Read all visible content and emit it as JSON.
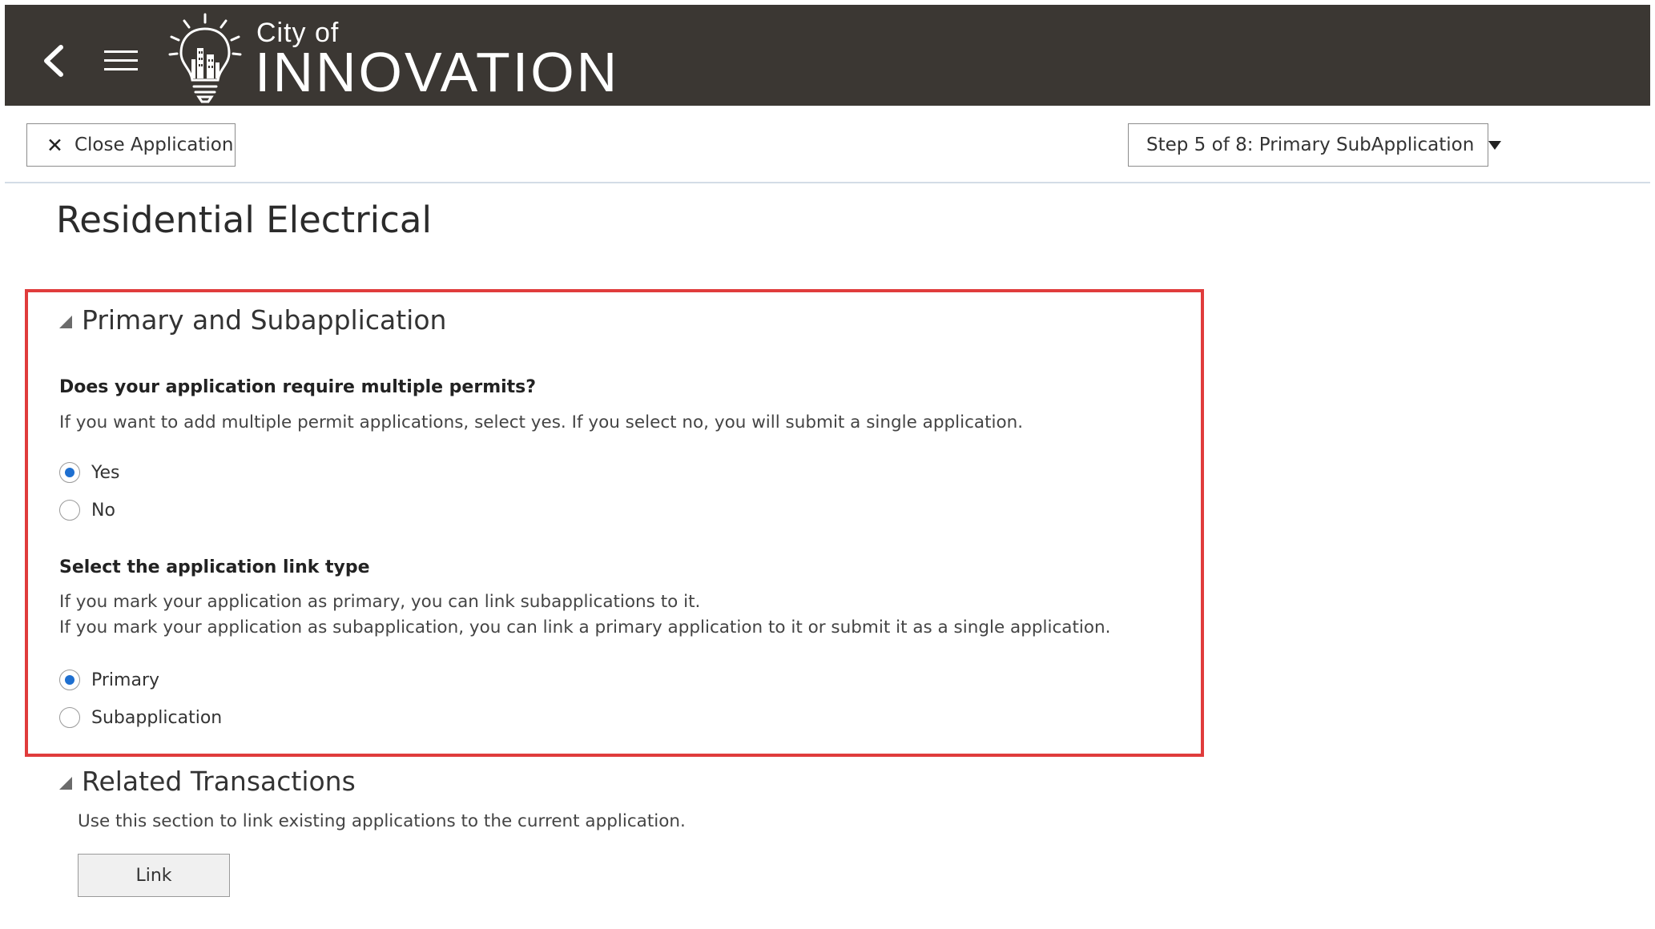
{
  "header": {
    "logo_small": "City of",
    "logo_big": "INNOVATION",
    "background_color": "#3b3733"
  },
  "toolbar": {
    "close_label": "Close Application",
    "step_label": "Step 5 of 8: Primary SubApplication"
  },
  "page": {
    "title": "Residential Electrical"
  },
  "section_primary": {
    "title": "Primary and Subapplication",
    "q1": {
      "label": "Does your application require multiple permits?",
      "help": "If you want to add multiple permit applications, select yes. If you select no, you will submit a single application.",
      "options": [
        "Yes",
        "No"
      ],
      "selected": "Yes"
    },
    "q2": {
      "label": "Select the application link type",
      "help_line1": "If you mark your application as primary, you can link subapplications to it.",
      "help_line2": "If you mark your application as subapplication, you can link a primary application to it or submit it as a single application.",
      "options": [
        "Primary",
        "Subapplication"
      ],
      "selected": "Primary"
    },
    "highlight_color": "#e03c3c"
  },
  "section_related": {
    "title": "Related Transactions",
    "help": "Use this section to link existing applications to the current application.",
    "link_label": "Link"
  },
  "colors": {
    "radio_selected": "#1e6fd0"
  }
}
